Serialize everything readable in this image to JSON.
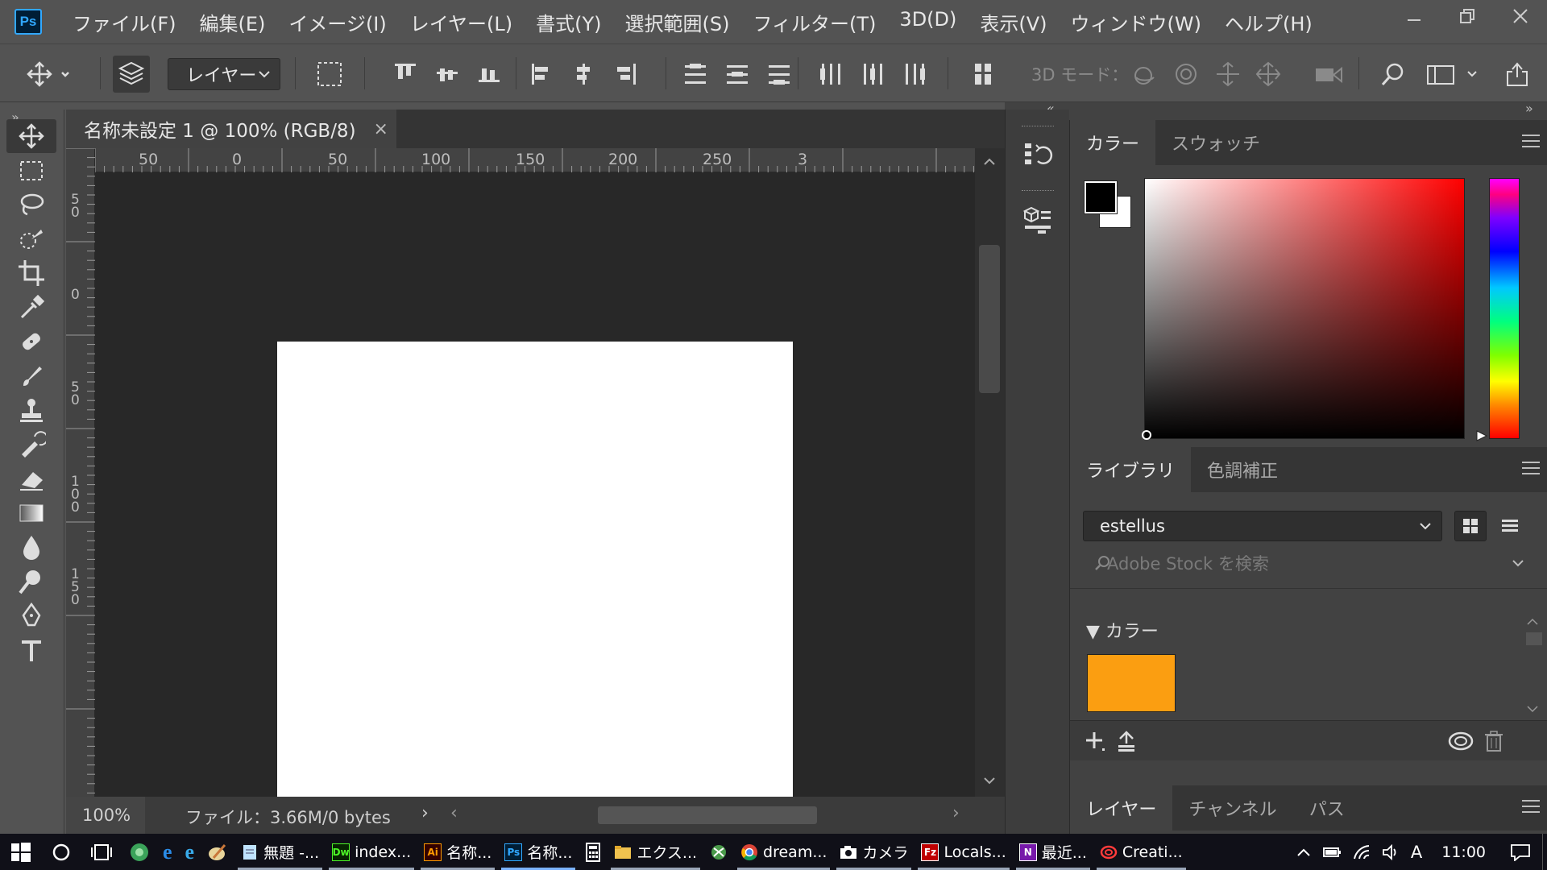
{
  "app": {
    "logo": "Ps",
    "document_tab": "名称未設定 1 @ 100% (RGB/8)"
  },
  "menu": [
    "ファイル(F)",
    "編集(E)",
    "イメージ(I)",
    "レイヤー(L)",
    "書式(Y)",
    "選択範囲(S)",
    "フィルター(T)",
    "3D(D)",
    "表示(V)",
    "ウィンドウ(W)",
    "ヘルプ(H)"
  ],
  "options": {
    "auto_select_value": "レイヤー",
    "mode_3d_label": "3D モード："
  },
  "rulers": {
    "h_labels": [
      "50",
      "0",
      "50",
      "100",
      "150",
      "200",
      "250",
      "3"
    ],
    "v_labels": [
      "5\n0",
      "0",
      "5\n0",
      "1\n0\n0",
      "1\n5\n0"
    ]
  },
  "status": {
    "zoom": "100%",
    "file_info": "ファイル：3.66M/0 bytes"
  },
  "color_panel": {
    "tabs": [
      "カラー",
      "スウォッチ"
    ],
    "foreground": "#000000",
    "background": "#ffffff"
  },
  "library_panel": {
    "tabs": [
      "ライブラリ",
      "色調補正"
    ],
    "library_name": "estellus",
    "search_placeholder": "Adobe Stock を検索",
    "section_title": "カラー",
    "swatch_color": "#fb9e11"
  },
  "layers_panel": {
    "tabs": [
      "レイヤー",
      "チャンネル",
      "パス"
    ]
  },
  "taskbar": {
    "apps": [
      {
        "label": "無題 -...",
        "icon": "notepad-icon"
      },
      {
        "label": "index...",
        "icon": "dreamweaver-icon",
        "badge": "Dw"
      },
      {
        "label": "名称...",
        "icon": "illustrator-icon",
        "badge": "Ai"
      },
      {
        "label": "名称...",
        "icon": "photoshop-icon",
        "badge": "Ps"
      },
      {
        "label": "エクス...",
        "icon": "explorer-icon"
      },
      {
        "label": "dream...",
        "icon": "chrome-icon"
      },
      {
        "label": "カメラ",
        "icon": "camera-icon"
      },
      {
        "label": "Locals...",
        "icon": "filezilla-icon",
        "badge": "Fz"
      },
      {
        "label": "最近...",
        "icon": "onenote-icon",
        "badge": "N"
      },
      {
        "label": "Creati...",
        "icon": "creative-cloud-icon"
      }
    ],
    "ime": "A",
    "time": "11:00"
  }
}
